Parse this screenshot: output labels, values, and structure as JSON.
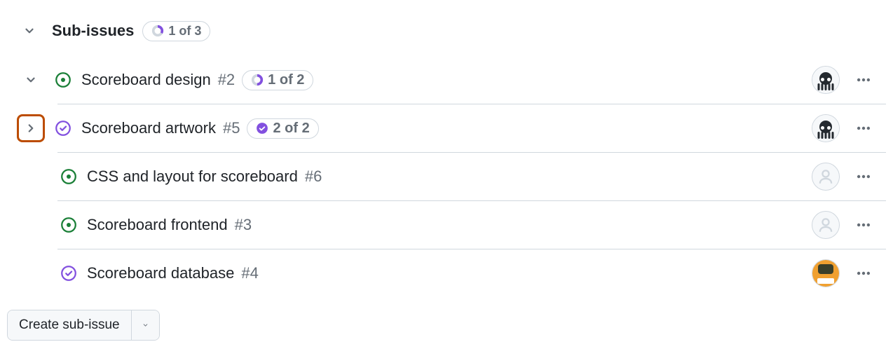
{
  "header": {
    "title": "Sub-issues",
    "progress_label": "1 of 3",
    "progress_done": 1,
    "progress_total": 3
  },
  "issues": {
    "i0": {
      "title": "Scoreboard design",
      "number": "#2",
      "status": "open",
      "has_children": true,
      "expanded": true,
      "progress_label": "1 of 2",
      "progress_done": 1,
      "progress_total": 2,
      "avatar": "octocat"
    },
    "i1": {
      "title": "Scoreboard artwork",
      "number": "#5",
      "status": "closed",
      "has_children": true,
      "expanded": false,
      "progress_label": "2 of 2",
      "progress_done": 2,
      "progress_total": 2,
      "avatar": "octocat",
      "highlighted_toggle": true
    },
    "i2": {
      "title": "CSS and layout for scoreboard",
      "number": "#6",
      "status": "open",
      "has_children": false,
      "avatar": "none"
    },
    "i3": {
      "title": "Scoreboard frontend",
      "number": "#3",
      "status": "open",
      "has_children": false,
      "avatar": "none"
    },
    "i4": {
      "title": "Scoreboard database",
      "number": "#4",
      "status": "closed",
      "has_children": false,
      "avatar": "hubot"
    }
  },
  "footer": {
    "create_label": "Create sub-issue"
  },
  "colors": {
    "open": "#1a7f37",
    "closed": "#8250df",
    "highlight": "#bc4c00"
  }
}
